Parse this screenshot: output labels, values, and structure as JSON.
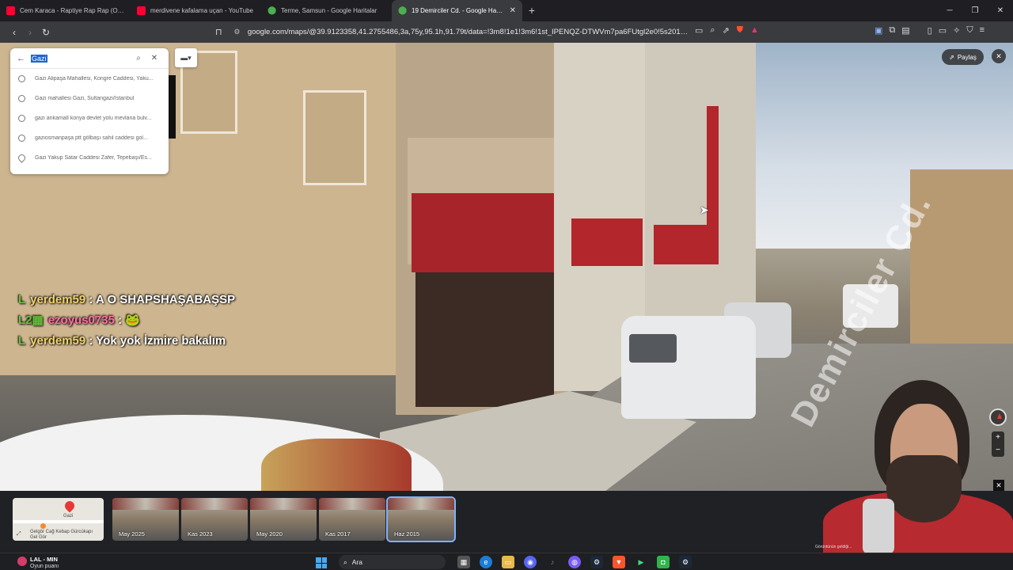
{
  "tabs": [
    {
      "title": "Cem Karaca - Raptiye Rap Rap (Offici",
      "icon": "youtube-icon"
    },
    {
      "title": "merdivene kafalama uçan - YouTube",
      "icon": "youtube-icon"
    },
    {
      "title": "Terme, Samsun - Google Haritalar",
      "icon": "maps-icon"
    },
    {
      "title": "19 Demirciler Cd. - Google Harita",
      "icon": "maps-icon",
      "active": true
    }
  ],
  "address": {
    "url": "google.com/maps/@39.9123358,41.2755486,3a,75y,95.1h,91.79t/data=!3m8!1e1!3m6!1st_IPENQZ-DTWVm7pa6FUtgl2e0!5s20150601T..."
  },
  "search": {
    "query": "Gazi",
    "suggestions": [
      {
        "text": "Gazi Alipaşa Mahallesi, Kongre Caddesi, Yaku...",
        "icon": "history-icon"
      },
      {
        "text": "Gazi mahallesi Gazi, Sultangazi/İstanbul",
        "icon": "history-icon"
      },
      {
        "text": "gazi ankamall konya devlet yolu mevlana bulv...",
        "icon": "history-icon"
      },
      {
        "text": "gaziosmanpaşa ptt gölbaşı sahil caddesi gol...",
        "icon": "history-icon"
      },
      {
        "text": "Gazi Yakup Satar Caddesi Zafer, Tepebaşı/Es...",
        "icon": "pin-icon"
      }
    ]
  },
  "streetview": {
    "share_label": "Paylaş",
    "road_label": "Demirciler Cd."
  },
  "chat": [
    {
      "user": "yerdem59",
      "message": " : A O SHAPSHAŞABAŞSP",
      "color": "#f2d36b"
    },
    {
      "user": "ezoyus0735",
      "message": " : 🐸",
      "color": "#ff6fa5"
    },
    {
      "user": "yerdem59",
      "message": " : Yok yok İzmire bakalım",
      "color": "#f2d36b"
    }
  ],
  "minimap": {
    "place": "Gazi",
    "label": "Gelgör Cağ Kebap Gürcükapı Gel Gör"
  },
  "timeline": [
    {
      "date": "May 2025"
    },
    {
      "date": "Kas 2023"
    },
    {
      "date": "May 2020"
    },
    {
      "date": "Kas 2017"
    },
    {
      "date": "Haz 2015",
      "selected": true
    }
  ],
  "cam": {
    "caption": "Görüntünün geldiği..."
  },
  "taskbar": {
    "weather_title": "LAL - MIN",
    "weather_sub": "Oyun puanı",
    "search_label": "Ara"
  }
}
